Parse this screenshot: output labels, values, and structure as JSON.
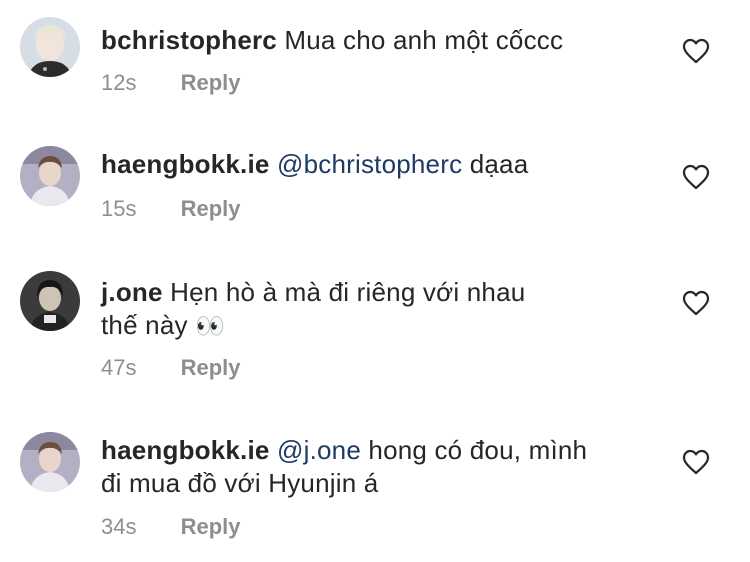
{
  "comments": [
    {
      "username": "bchristopherc",
      "mention": "",
      "text_line1": "Mua cho anh một cốccc",
      "text_line2": "",
      "time": "12s",
      "reply_label": "Reply",
      "avatar_bg": "#d9dfe6"
    },
    {
      "username": "haengbokk.ie",
      "mention": "@bchristopherc",
      "text_line1": "dạaa",
      "text_line2": "",
      "time": "15s",
      "reply_label": "Reply",
      "avatar_bg": "#b8b0c6"
    },
    {
      "username": "j.one",
      "mention": "",
      "text_line1": "Hẹn hò à mà đi riêng với nhau",
      "text_line2": "thế này",
      "emoji": "👀",
      "time": "47s",
      "reply_label": "Reply",
      "avatar_bg": "#3a3a3a"
    },
    {
      "username": "haengbokk.ie",
      "mention": "@j.one",
      "text_line1": "hong có đou, mình",
      "text_line2": "đi mua đồ với Hyunjin á",
      "time": "34s",
      "reply_label": "Reply",
      "avatar_bg": "#b8b0c6"
    }
  ],
  "colors": {
    "text": "#262626",
    "mention": "#1e3a66",
    "meta": "#8e8e8e",
    "heart_stroke": "#262626"
  },
  "icons": {
    "like": "heart-outline-icon"
  }
}
